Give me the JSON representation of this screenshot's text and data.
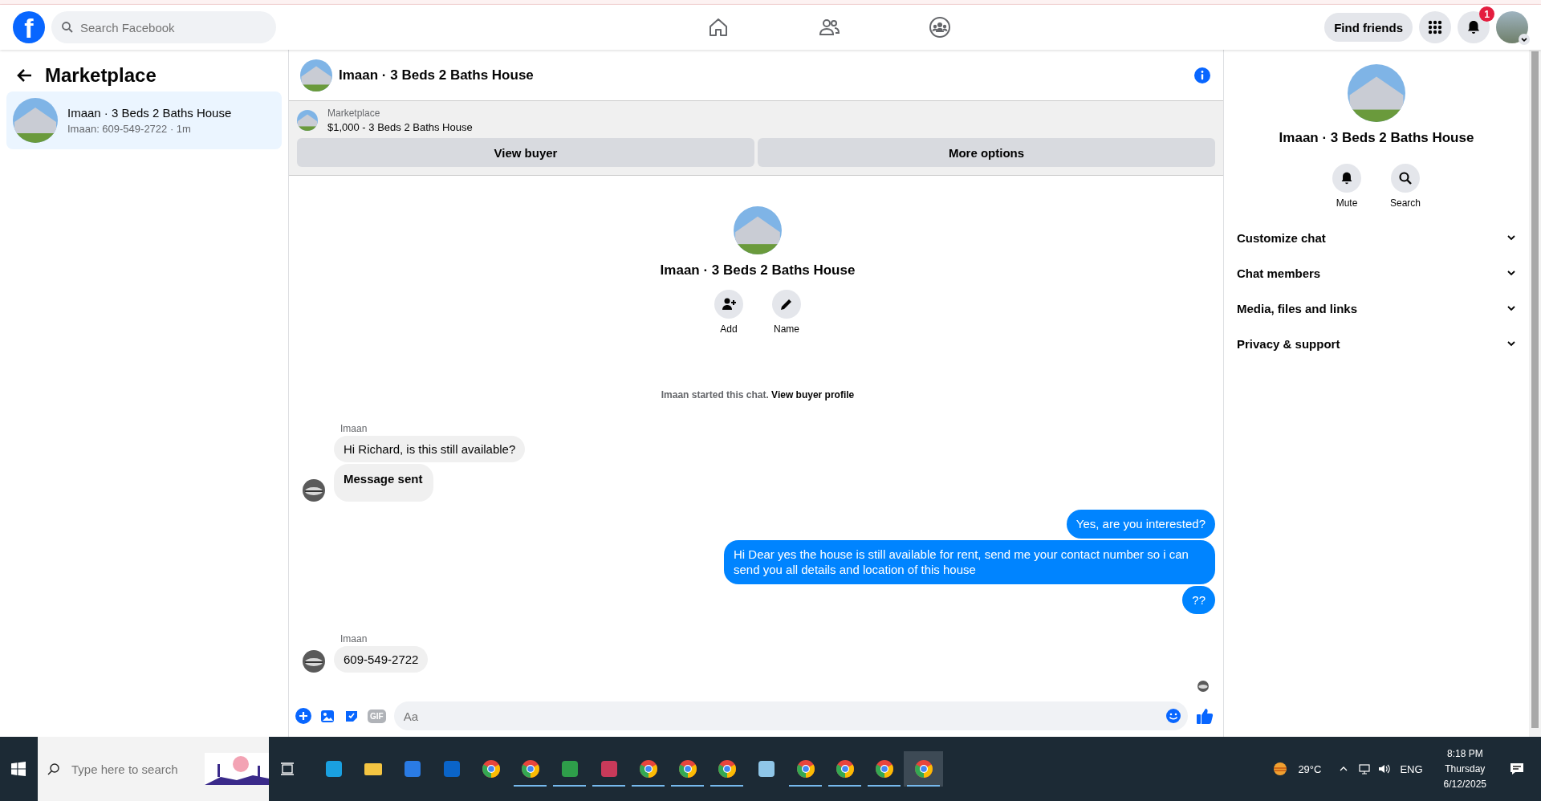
{
  "nav": {
    "logo": "f",
    "search": {
      "placeholder": "Search Facebook"
    },
    "find_friends": "Find friends",
    "notification_count": "1"
  },
  "sidebar": {
    "title": "Marketplace",
    "conversations": [
      {
        "title": "Imaan · 3 Beds 2 Baths House",
        "preview": "Imaan: 609-549-2722 · 1m",
        "selected": true
      }
    ]
  },
  "chat": {
    "title": "Imaan · 3 Beds 2 Baths House",
    "listing": {
      "label": "Marketplace",
      "title": "$1,000 - 3 Beds 2 Baths House"
    },
    "buttons": [
      "View buyer",
      "More options"
    ],
    "intro": {
      "title": "Imaan · 3 Beds 2 Baths House",
      "actions": [
        {
          "label": "Add",
          "kind": "add"
        },
        {
          "label": "Name",
          "kind": "edit"
        }
      ]
    },
    "note": {
      "text": "Imaan started this chat.",
      "link": "View buyer profile"
    },
    "messages": [
      {
        "kind": "sender",
        "text": "Imaan"
      },
      {
        "kind": "in",
        "text": "Hi Richard, is this still available?",
        "avatar": false,
        "bold": false
      },
      {
        "kind": "in",
        "text": "Message sent",
        "avatar": true,
        "bold": true
      },
      {
        "kind": "out",
        "text": "Yes, are you interested?"
      },
      {
        "kind": "out",
        "text": "Hi Dear yes the house is still available for rent, send me your contact number so i can send you all details and location of this house"
      },
      {
        "kind": "out",
        "text": "??"
      },
      {
        "kind": "sender",
        "text": "Imaan"
      },
      {
        "kind": "in",
        "text": "609-549-2722",
        "avatar": true,
        "bold": false
      }
    ],
    "composer": {
      "placeholder": "Aa",
      "tools": [
        {
          "kind": "plus"
        },
        {
          "kind": "image"
        },
        {
          "kind": "sticker"
        },
        {
          "kind": "gif",
          "label": "GIF"
        }
      ]
    }
  },
  "details": {
    "title": "Imaan · 3 Beds 2 Baths House",
    "actions": [
      {
        "label": "Mute",
        "kind": "bell"
      },
      {
        "label": "Search",
        "kind": "search"
      }
    ],
    "sections": [
      {
        "label": "Customize chat",
        "expanded": false
      },
      {
        "label": "Chat members",
        "expanded": false
      },
      {
        "label": "Media, files and links",
        "expanded": false
      },
      {
        "label": "Privacy & support",
        "expanded": false
      }
    ]
  },
  "taskbar": {
    "search": {
      "placeholder": "Type here to search"
    },
    "apps": [
      {
        "kind": "edge",
        "running": false,
        "active": false
      },
      {
        "kind": "folder",
        "running": false,
        "active": false
      },
      {
        "kind": "store",
        "running": false,
        "active": false
      },
      {
        "kind": "outlook",
        "running": false,
        "active": false
      },
      {
        "kind": "chrome",
        "running": false,
        "active": false
      },
      {
        "kind": "chrome",
        "running": true,
        "active": false
      },
      {
        "kind": "sheet",
        "running": true,
        "active": false
      },
      {
        "kind": "paint",
        "running": true,
        "active": false
      },
      {
        "kind": "chrome",
        "running": true,
        "active": false
      },
      {
        "kind": "chrome",
        "running": true,
        "active": false
      },
      {
        "kind": "chrome",
        "running": true,
        "active": false
      },
      {
        "kind": "notepad",
        "running": false,
        "active": false
      },
      {
        "kind": "chrome",
        "running": true,
        "active": false
      },
      {
        "kind": "chrome",
        "running": true,
        "active": false
      },
      {
        "kind": "chrome",
        "running": true,
        "active": false
      },
      {
        "kind": "chrome",
        "running": true,
        "active": true
      }
    ],
    "temperature": "29°C",
    "language": "ENG",
    "time": "8:18 PM",
    "day": "Thursday",
    "date": "6/12/2025"
  }
}
